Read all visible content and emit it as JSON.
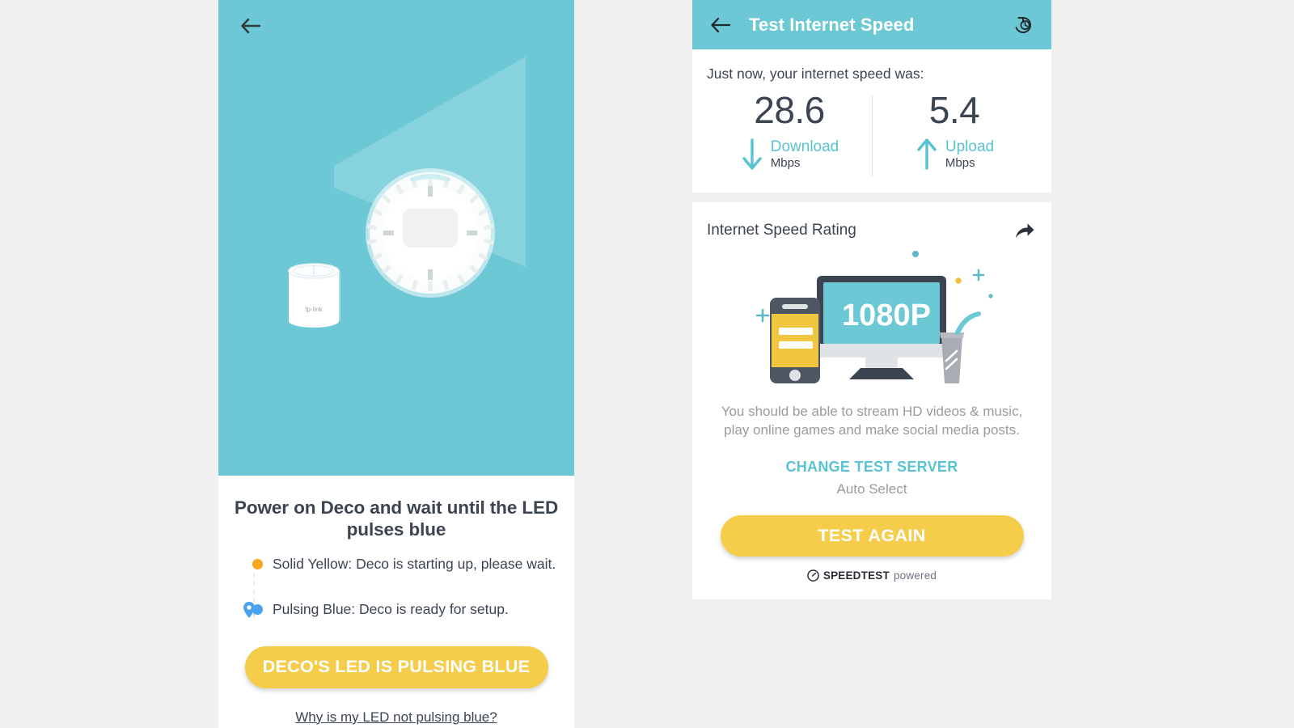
{
  "colors": {
    "teal": "#6cc8d4",
    "teal_text": "#59c3d1",
    "yellow": "#f6cc4b",
    "dark_text": "#3b4450",
    "muted_text": "#9b9b9b",
    "page_bg": "#f0f0f0",
    "led_yellow": "#f5a623",
    "led_blue": "#4aa3f0"
  },
  "left_screen": {
    "back_icon": "arrow-left-icon",
    "illustration": {
      "device_brand": "tp-link",
      "device_name": "Deco",
      "zoom_callout": "deco-top-led-ring"
    },
    "title": "Power on Deco and wait until the LED pulses blue",
    "led_states": [
      {
        "dot_color": "#f5a623",
        "text": "Solid Yellow: Deco is starting up, please wait."
      },
      {
        "dot_color": "#4aa3f0",
        "text": "Pulsing Blue: Deco is ready for setup.",
        "marker": "map-pin-icon"
      }
    ],
    "primary_button": "DECO'S LED IS PULSING BLUE",
    "help_link": "Why is my LED not pulsing blue?"
  },
  "right_screen": {
    "app_bar": {
      "back_icon": "arrow-left-icon",
      "title": "Test Internet Speed",
      "history_icon": "history-icon"
    },
    "results": {
      "caption": "Just now, your internet speed was:",
      "download": {
        "value": "28.6",
        "label": "Download",
        "unit": "Mbps",
        "icon": "arrow-down-icon"
      },
      "upload": {
        "value": "5.4",
        "label": "Upload",
        "unit": "Mbps",
        "icon": "arrow-up-icon"
      }
    },
    "rating": {
      "title": "Internet Speed Rating",
      "share_icon": "share-icon",
      "illustration_label": "1080P",
      "description": "You should be able to stream HD videos & music, play online games and make social media posts.",
      "change_server_label": "CHANGE TEST SERVER",
      "server_value": "Auto Select",
      "test_again_label": "TEST AGAIN",
      "powered_by": {
        "mark": "speedtest-gauge-icon",
        "bold": "SPEEDTEST",
        "light": "powered"
      }
    }
  }
}
